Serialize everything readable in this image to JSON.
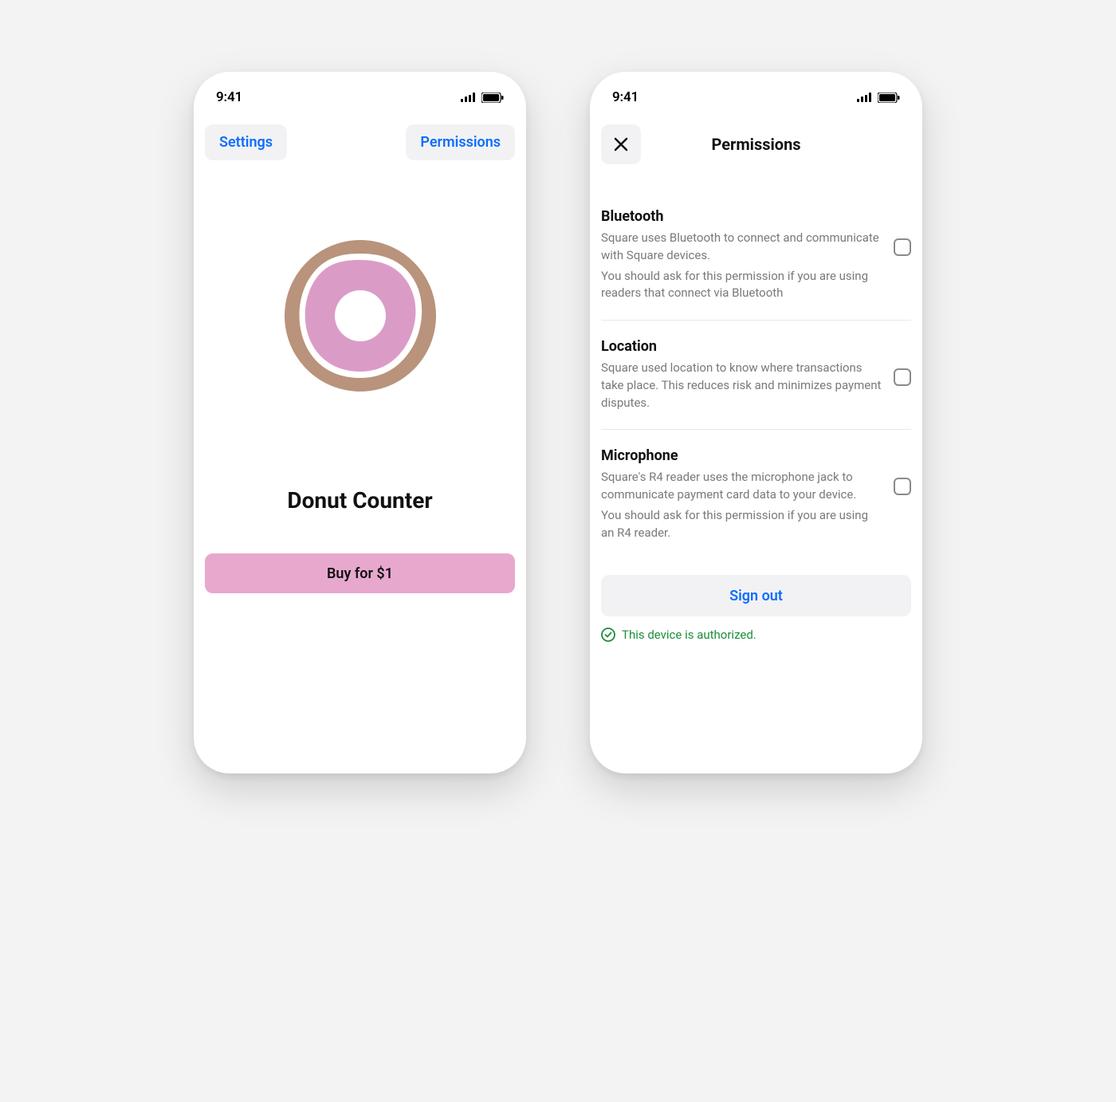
{
  "status": {
    "time": "9:41"
  },
  "screen1": {
    "nav": {
      "settings": "Settings",
      "permissions": "Permissions"
    },
    "title": "Donut Counter",
    "buy_label": "Buy for $1"
  },
  "screen2": {
    "title": "Permissions",
    "permissions": [
      {
        "title": "Bluetooth",
        "desc1": "Square uses Bluetooth to connect and communicate with Square devices.",
        "desc2": "You should ask for this permission if you are using readers that connect via Bluetooth"
      },
      {
        "title": "Location",
        "desc1": "Square used location to know where transactions take place. This reduces risk and minimizes payment disputes.",
        "desc2": ""
      },
      {
        "title": "Microphone",
        "desc1": "Square's R4 reader uses the microphone jack to communicate payment card data to your device.",
        "desc2": "You should ask for this permission if you are using an R4 reader."
      }
    ],
    "signout_label": "Sign out",
    "auth_status": "This device is authorized."
  }
}
